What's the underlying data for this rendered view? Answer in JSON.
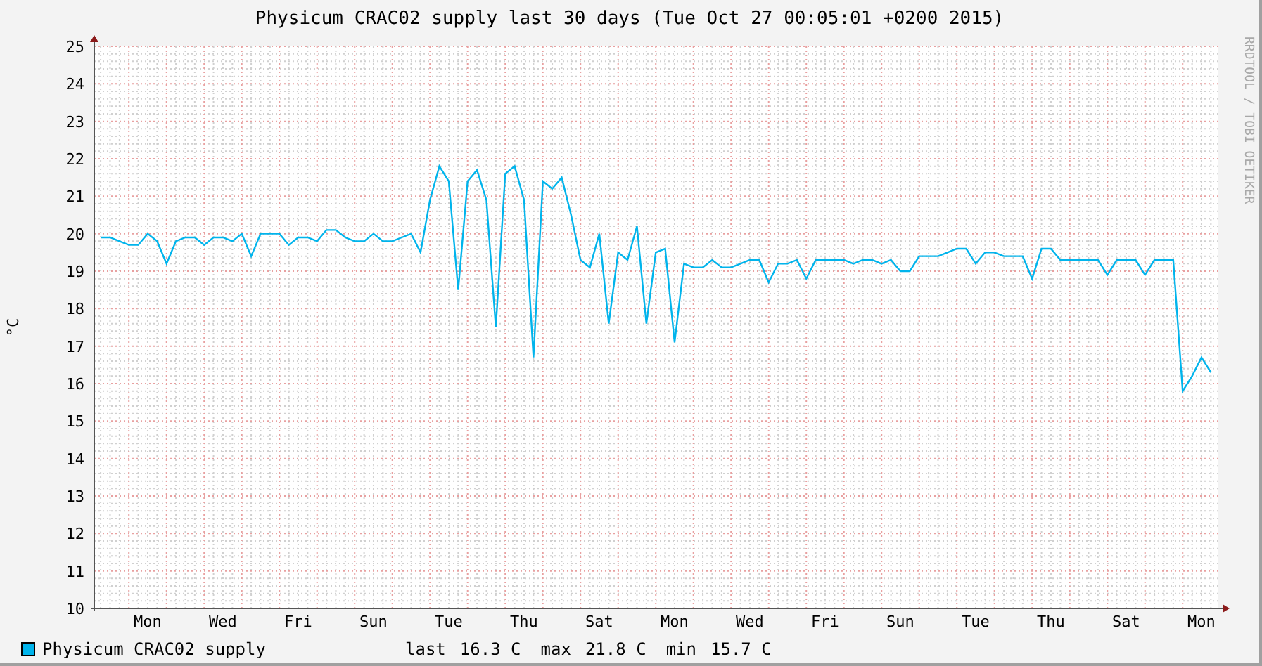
{
  "graph": {
    "title": "Physicum CRAC02 supply last 30 days (Tue Oct 27 00:05:01 +0200 2015)",
    "watermark": "RRDTOOL / TOBI OETIKER",
    "chart_data": {
      "type": "line",
      "grid": true,
      "ylabel": "°C",
      "ylim": [
        10,
        25
      ],
      "yticks": [
        10,
        11,
        12,
        13,
        14,
        15,
        16,
        17,
        18,
        19,
        20,
        21,
        22,
        23,
        24,
        25
      ],
      "categories": [
        null,
        null,
        null,
        null,
        null,
        "Mon",
        null,
        null,
        null,
        null,
        null,
        null,
        null,
        "Wed",
        null,
        null,
        null,
        null,
        null,
        null,
        null,
        "Fri",
        null,
        null,
        null,
        null,
        null,
        null,
        null,
        "Sun",
        null,
        null,
        null,
        null,
        null,
        null,
        null,
        "Tue",
        null,
        null,
        null,
        null,
        null,
        null,
        null,
        "Thu",
        null,
        null,
        null,
        null,
        null,
        null,
        null,
        "Sat",
        null,
        null,
        null,
        null,
        null,
        null,
        null,
        "Mon",
        null,
        null,
        null,
        null,
        null,
        null,
        null,
        "Wed",
        null,
        null,
        null,
        null,
        null,
        null,
        null,
        "Fri",
        null,
        null,
        null,
        null,
        null,
        null,
        null,
        "Sun",
        null,
        null,
        null,
        null,
        null,
        null,
        null,
        "Tue",
        null,
        null,
        null,
        null,
        null,
        null,
        null,
        "Thu",
        null,
        null,
        null,
        null,
        null,
        null,
        null,
        "Sat",
        null,
        null,
        null,
        null,
        null,
        null,
        null,
        "Mon",
        null
      ],
      "series": [
        {
          "name": "Physicum CRAC02 supply",
          "color": "#00b4ec",
          "values": [
            19.9,
            19.9,
            19.8,
            19.7,
            19.7,
            20.0,
            19.8,
            19.2,
            19.8,
            19.9,
            19.9,
            19.7,
            19.9,
            19.9,
            19.8,
            20.0,
            19.4,
            20.0,
            20.0,
            20.0,
            19.7,
            19.9,
            19.9,
            19.8,
            20.1,
            20.1,
            19.9,
            19.8,
            19.8,
            20.0,
            19.8,
            19.8,
            19.9,
            20.0,
            19.5,
            20.9,
            21.8,
            21.4,
            18.5,
            21.4,
            21.7,
            20.9,
            17.5,
            21.6,
            21.8,
            20.9,
            16.7,
            21.4,
            21.2,
            21.5,
            20.5,
            19.3,
            19.1,
            20.0,
            17.6,
            19.5,
            19.3,
            20.2,
            17.6,
            19.5,
            19.6,
            17.1,
            19.2,
            19.1,
            19.1,
            19.3,
            19.1,
            19.1,
            19.2,
            19.3,
            19.3,
            18.7,
            19.2,
            19.2,
            19.3,
            18.8,
            19.3,
            19.3,
            19.3,
            19.3,
            19.2,
            19.3,
            19.3,
            19.2,
            19.3,
            19.0,
            19.0,
            19.4,
            19.4,
            19.4,
            19.5,
            19.6,
            19.6,
            19.2,
            19.5,
            19.5,
            19.4,
            19.4,
            19.4,
            18.8,
            19.6,
            19.6,
            19.3,
            19.3,
            19.3,
            19.3,
            19.3,
            18.9,
            19.3,
            19.3,
            19.3,
            18.9,
            19.3,
            19.3,
            19.3,
            15.8,
            16.2,
            16.7,
            16.3
          ]
        }
      ]
    }
  },
  "legend": {
    "stats": [
      {
        "label": "last",
        "value": "16.3 C"
      },
      {
        "label": "max",
        "value": "21.8 C"
      },
      {
        "label": "min",
        "value": "15.7 C"
      }
    ]
  }
}
